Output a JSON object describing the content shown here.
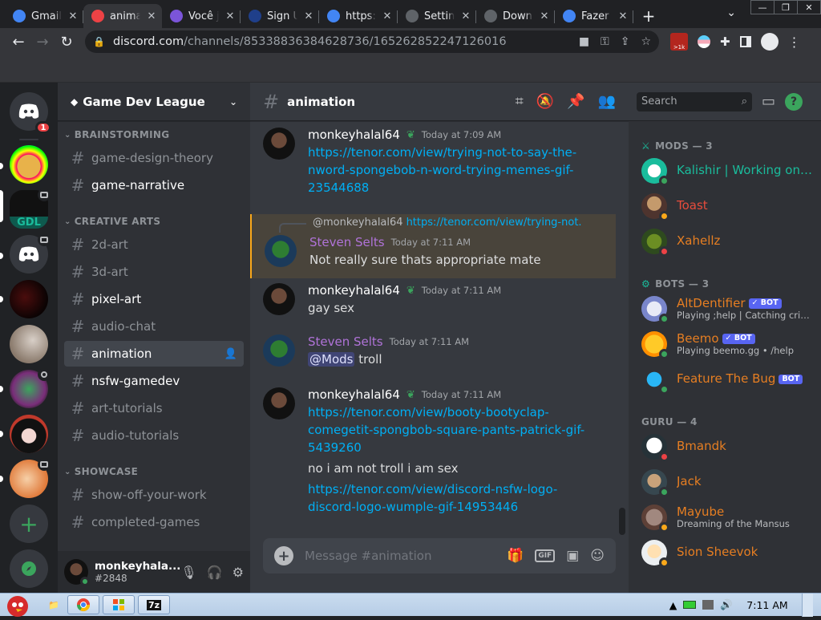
{
  "browser": {
    "tabs": [
      {
        "title": "Gmail",
        "icon": "google-icon",
        "color": "#4285f4",
        "active": false
      },
      {
        "title": "animation",
        "icon": "discord-icon",
        "color": "#ed4245",
        "active": true
      },
      {
        "title": "Você j",
        "icon": "notion-icon",
        "color": "#7b55d9",
        "active": false
      },
      {
        "title": "Sign U",
        "icon": "vl-icon",
        "color": "#1f3f8a",
        "active": false
      },
      {
        "title": "https:",
        "icon": "google-icon",
        "color": "#4285f4",
        "active": false
      },
      {
        "title": "Settin",
        "icon": "gear-icon",
        "color": "#5f6368",
        "active": false
      },
      {
        "title": "Down",
        "icon": "download-icon",
        "color": "#5f6368",
        "active": false
      },
      {
        "title": "Fazer",
        "icon": "google-icon",
        "color": "#4285f4",
        "active": false
      }
    ],
    "url_host": "discord.com",
    "url_path": "/channels/853388363846287​36/165262852247126016",
    "extension_badge": ">1k"
  },
  "server": {
    "name": "Game Dev League",
    "home_badge": "1"
  },
  "channel_list": {
    "categories": [
      {
        "label": "BRAINSTORMING"
      },
      {
        "label": "CREATIVE ARTS"
      },
      {
        "label": "SHOWCASE"
      }
    ],
    "channels": [
      {
        "name": "game-design-theory",
        "state": "read"
      },
      {
        "name": "game-narrative",
        "state": "unread"
      },
      {
        "name": "2d-art",
        "state": "read"
      },
      {
        "name": "3d-art",
        "state": "read"
      },
      {
        "name": "pixel-art",
        "state": "unread"
      },
      {
        "name": "audio-chat",
        "state": "read"
      },
      {
        "name": "animation",
        "state": "selected"
      },
      {
        "name": "nsfw-gamedev",
        "state": "unread"
      },
      {
        "name": "art-tutorials",
        "state": "read"
      },
      {
        "name": "audio-tutorials",
        "state": "read"
      },
      {
        "name": "show-off-your-work",
        "state": "read"
      },
      {
        "name": "completed-games",
        "state": "read"
      }
    ]
  },
  "user_panel": {
    "username": "monkeyhala...",
    "tag": "#2848"
  },
  "chat": {
    "channel_name": "animation",
    "composer_placeholder": "Message #animation",
    "messages": [
      {
        "author": "monkeyhalal64",
        "author_color": "#ffffff",
        "time": "Today at 7:09 AM",
        "lines": [
          {
            "kind": "link",
            "text": "https://tenor.com/view/trying-not-to-say-the-"
          },
          {
            "kind": "link",
            "text": "nword-spongebob-n-word-trying-memes-gif-"
          },
          {
            "kind": "link",
            "text": "23544688"
          }
        ]
      },
      {
        "reply_author": "@monkeyhalal64",
        "reply_text": "https://tenor.com/view/trying-not...",
        "author": "Steven Selts",
        "author_color": "#b073d8",
        "time": "Today at 7:11 AM",
        "lines": [
          {
            "kind": "text",
            "text": "Not really sure thats appropriate mate"
          }
        ]
      },
      {
        "author": "monkeyhalal64",
        "author_color": "#ffffff",
        "time": "Today at 7:11 AM",
        "lines": [
          {
            "kind": "text",
            "text": "gay sex"
          }
        ]
      },
      {
        "author": "Steven Selts",
        "author_color": "#b073d8",
        "time": "Today at 7:11 AM",
        "mention": "@Mods",
        "lines": [
          {
            "kind": "text",
            "text": "troll"
          }
        ]
      },
      {
        "author": "monkeyhalal64",
        "author_color": "#ffffff",
        "time": "Today at 7:11 AM",
        "lines": [
          {
            "kind": "link",
            "text": "https://tenor.com/view/booty-bootyclap-"
          },
          {
            "kind": "link",
            "text": "comegetit-spongbob-square-pants-patrick-gif-"
          },
          {
            "kind": "link",
            "text": "5439260"
          },
          {
            "kind": "text",
            "text": "no i am not troll i am sex"
          },
          {
            "kind": "link",
            "text": "https://tenor.com/view/discord-nsfw-logo-"
          },
          {
            "kind": "link",
            "text": "discord-logo-wumple-gif-14953446"
          }
        ]
      }
    ]
  },
  "members": {
    "search_placeholder": "Search",
    "groups": [
      {
        "label": "MODS — 3"
      },
      {
        "label": "BOTS — 3"
      },
      {
        "label": "GURU — 4"
      }
    ],
    "people": [
      {
        "name": "Kalishir | Working on n...",
        "color": "#1abc9c",
        "status": "#3ba55d",
        "bot": false,
        "sub": ""
      },
      {
        "name": "Toast",
        "color": "#e74c3c",
        "status": "#faa81a",
        "bot": false,
        "sub": ""
      },
      {
        "name": "Xahellz",
        "color": "#e67e22",
        "status": "#ed4245",
        "bot": false,
        "sub": ""
      },
      {
        "name": "AltDentifier",
        "color": "#e67e22",
        "status": "#3ba55d",
        "bot": true,
        "verified": true,
        "sub": "Playing ;help | Catching crimin..."
      },
      {
        "name": "Beemo",
        "color": "#e67e22",
        "status": "#3ba55d",
        "bot": true,
        "verified": true,
        "sub": "Playing beemo.gg • /help"
      },
      {
        "name": "Feature The Bug",
        "color": "#e67e22",
        "status": "#3ba55d",
        "bot": true,
        "verified": false,
        "sub": ""
      },
      {
        "name": "Bmandk",
        "color": "#e67e22",
        "status": "#ed4245",
        "bot": false,
        "sub": ""
      },
      {
        "name": "Jack",
        "color": "#e67e22",
        "status": "#3ba55d",
        "bot": false,
        "sub": ""
      },
      {
        "name": "Mayube",
        "color": "#e67e22",
        "status": "#faa81a",
        "bot": false,
        "sub": "Dreaming of the Mansus"
      },
      {
        "name": "Sion Sheevok",
        "color": "#e67e22",
        "status": "#faa81a",
        "bot": false,
        "sub": ""
      }
    ],
    "bot_label": "BOT"
  },
  "taskbar": {
    "clock": "7:11 AM",
    "app_7z": "7z"
  }
}
